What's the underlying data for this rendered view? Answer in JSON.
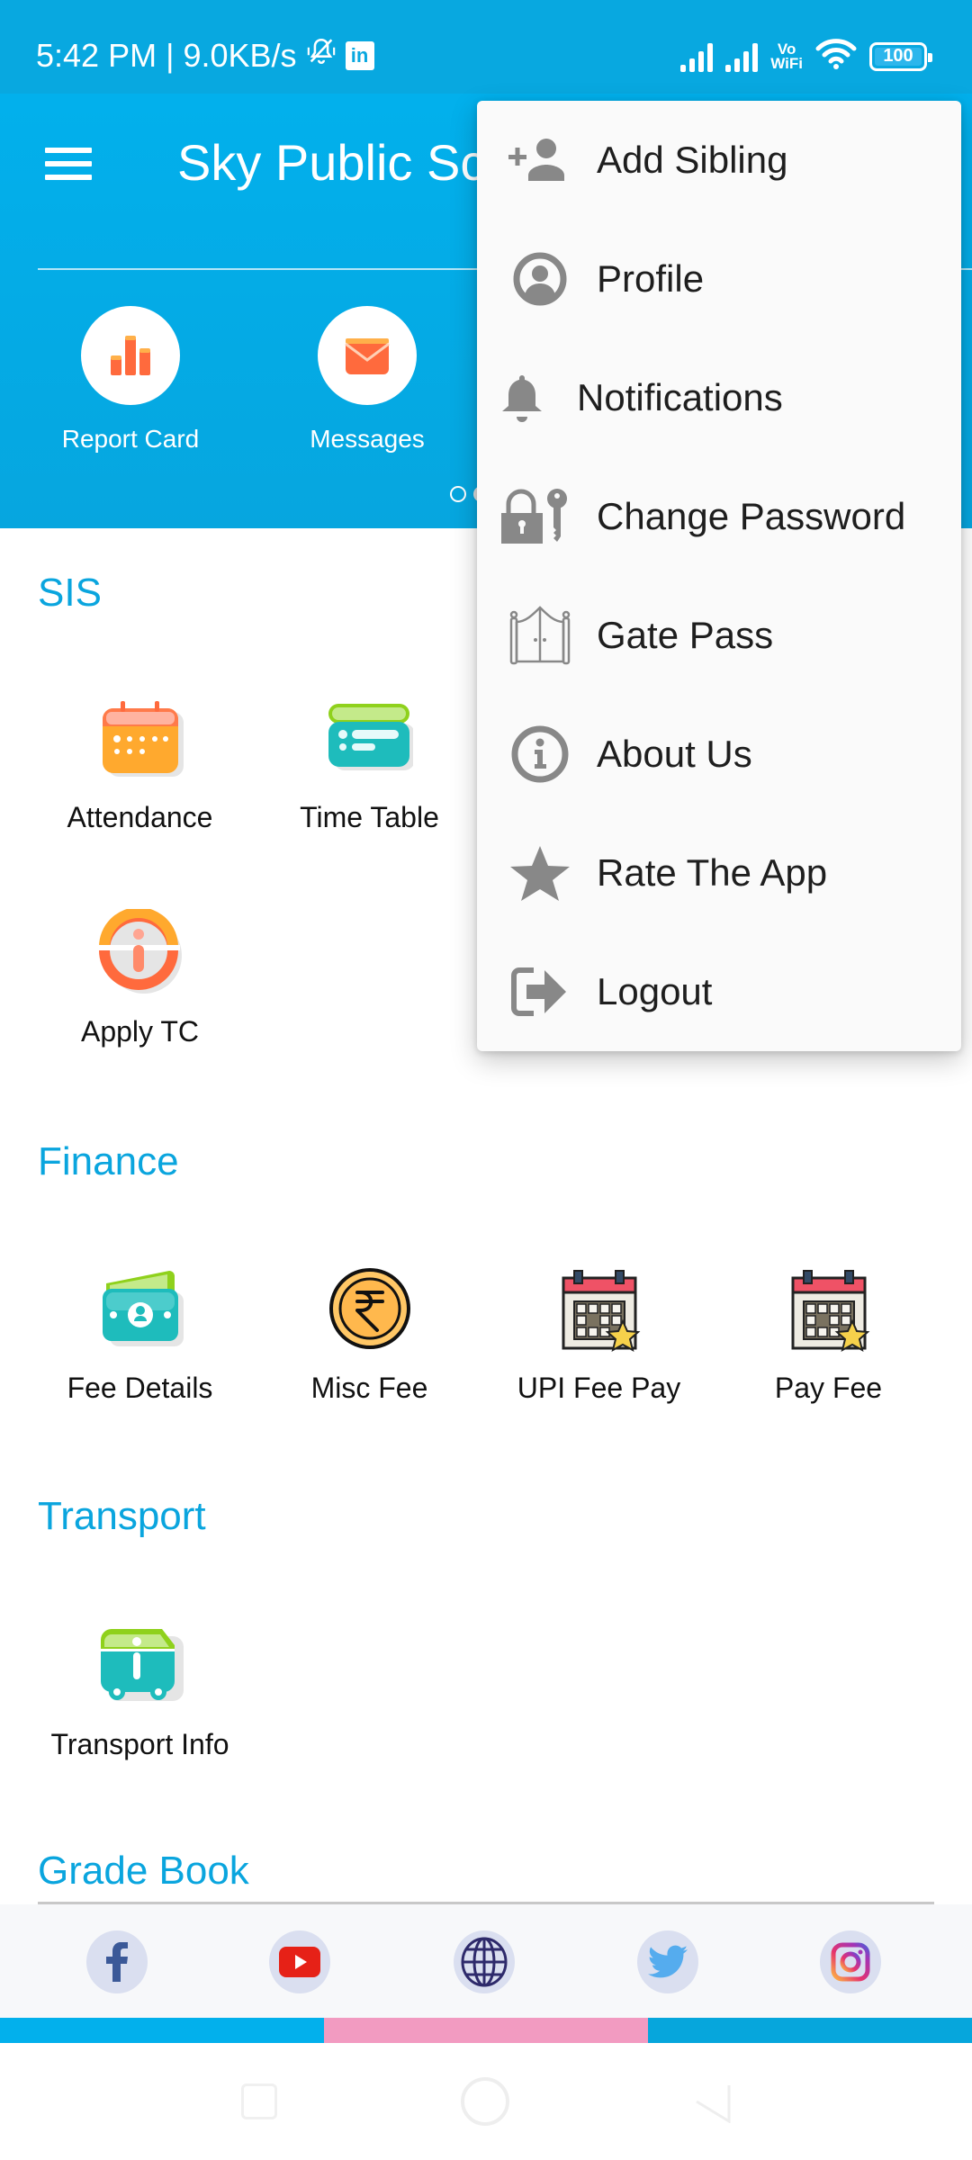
{
  "status_bar": {
    "time": "5:42 PM",
    "separator": "|",
    "network_speed": "9.0KB/s",
    "icons": [
      "bell-off-icon",
      "linkedin-icon",
      "signal-icon",
      "signal-icon",
      "vowifi-icon",
      "wifi-icon",
      "battery-icon"
    ],
    "linkedin_label": "in",
    "vowifi_top": "Vo",
    "vowifi_bottom": "WiFi",
    "battery_level": "100"
  },
  "header": {
    "title": "Sky Public School",
    "title_visible": "Sky Public Sc",
    "menu_icon": "hamburger-icon",
    "quick_links": [
      {
        "label": "Report Card",
        "icon": "bar-chart-icon"
      },
      {
        "label": "Messages",
        "icon": "envelope-icon"
      }
    ],
    "carousel_pages": 2,
    "carousel_active": 2
  },
  "sections": [
    {
      "title": "SIS",
      "items": [
        {
          "label": "Attendance",
          "icon": "calendar-icon"
        },
        {
          "label": "Time Table",
          "icon": "timetable-icon"
        },
        {
          "label": "Apply TC",
          "icon": "info-circle-icon"
        }
      ]
    },
    {
      "title": "Finance",
      "items": [
        {
          "label": "Fee Details",
          "icon": "wallet-icon"
        },
        {
          "label": "Misc Fee",
          "icon": "rupee-coin-icon"
        },
        {
          "label": "UPI Fee Pay",
          "icon": "calendar-star-icon"
        },
        {
          "label": "Pay Fee",
          "icon": "calendar-star-icon"
        }
      ]
    },
    {
      "title": "Transport",
      "items": [
        {
          "label": "Transport Info",
          "icon": "bus-info-icon"
        }
      ]
    },
    {
      "title": "Grade Book",
      "items": []
    }
  ],
  "social_links": [
    {
      "name": "facebook",
      "icon": "facebook-icon"
    },
    {
      "name": "youtube",
      "icon": "youtube-icon"
    },
    {
      "name": "website",
      "icon": "globe-icon"
    },
    {
      "name": "twitter",
      "icon": "twitter-icon"
    },
    {
      "name": "instagram",
      "icon": "instagram-icon"
    }
  ],
  "footer_strip_colors": [
    "#02b0ec",
    "#f29bc1",
    "#06a6dc"
  ],
  "overflow_menu": {
    "items": [
      {
        "label": "Add Sibling",
        "icon": "add-person-icon"
      },
      {
        "label": "Profile",
        "icon": "profile-icon"
      },
      {
        "label": "Notifications",
        "icon": "bell-icon"
      },
      {
        "label": "Change Password",
        "icon": "lock-key-icon"
      },
      {
        "label": "Gate Pass",
        "icon": "gate-icon"
      },
      {
        "label": "About Us",
        "icon": "info-icon"
      },
      {
        "label": "Rate The App",
        "icon": "star-icon"
      },
      {
        "label": "Logout",
        "icon": "logout-icon"
      }
    ]
  },
  "nav_bar": {
    "buttons": [
      "recents-button",
      "home-button",
      "back-button"
    ]
  },
  "colors": {
    "primary": "#08a8e0",
    "section_title": "#0aa5de",
    "menu_icon": "#888888",
    "menu_text": "#1e1e1e"
  }
}
